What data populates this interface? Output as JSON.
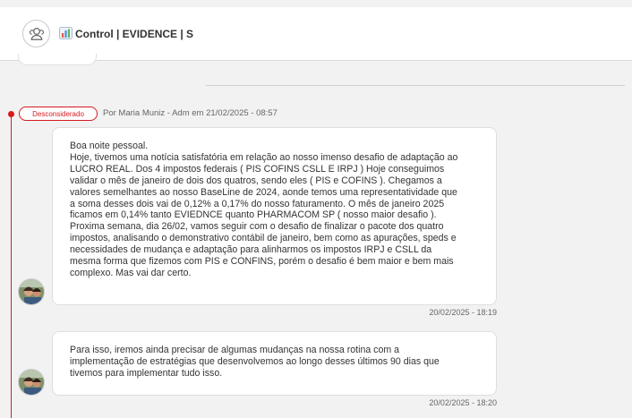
{
  "header": {
    "title_icon": "bar-chart-emoji-icon",
    "title": "Control | EVIDENCE | S",
    "group_icon": "users-group-icon"
  },
  "thread": {
    "status_badge": "Desconsiderado",
    "meta": "Por Maria Muniz - Adm em 21/02/2025 - 08:57",
    "accent_color": "#d71920"
  },
  "messages": [
    {
      "lines": [
        "Boa noite pessoal.",
        "Hoje, tivemos uma notícia satisfatória em relação ao nosso imenso desafio de adaptação ao",
        "LUCRO REAL. Dos 4 impostos federais ( PIS COFINS CSLL E IRPJ ) Hoje conseguimos",
        "validar o mês de janeiro de dois dos quatros, sendo eles ( PIS e COFINS ). Chegamos a",
        "valores semelhantes ao nosso BaseLine de 2024, aonde temos uma representatividade que",
        "a soma desses dois vai de 0,12% a 0,17% do nosso faturamento. O mês de janeiro 2025",
        "ficamos em 0,14% tanto EVIEDNCE quanto PHARMACOM SP ( nosso maior desafio ).",
        "Proxima semana, dia 26/02, vamos seguir com o desafio de finalizar o pacote dos quatro",
        "impostos, analisando o demonstrativo contábil de janeiro, bem como as apurações, speds e",
        "necessidades de mudança e adaptação para alinharmos os impostos IRPJ e CSLL da",
        "mesma forma que fizemos com PIS e CONFINS, porém o desafio é bem maior e bem mais",
        "complexo. Mas vai dar certo."
      ],
      "timestamp": "20/02/2025 - 18:19"
    },
    {
      "lines": [
        "Para isso, iremos ainda precisar de algumas mudanças na nossa rotina com a",
        "implementação de estratégias que desenvolvemos ao longo desses últimos 90 dias que",
        "tivemos para implementar tudo isso."
      ],
      "timestamp": "20/02/2025 - 18:20"
    }
  ]
}
